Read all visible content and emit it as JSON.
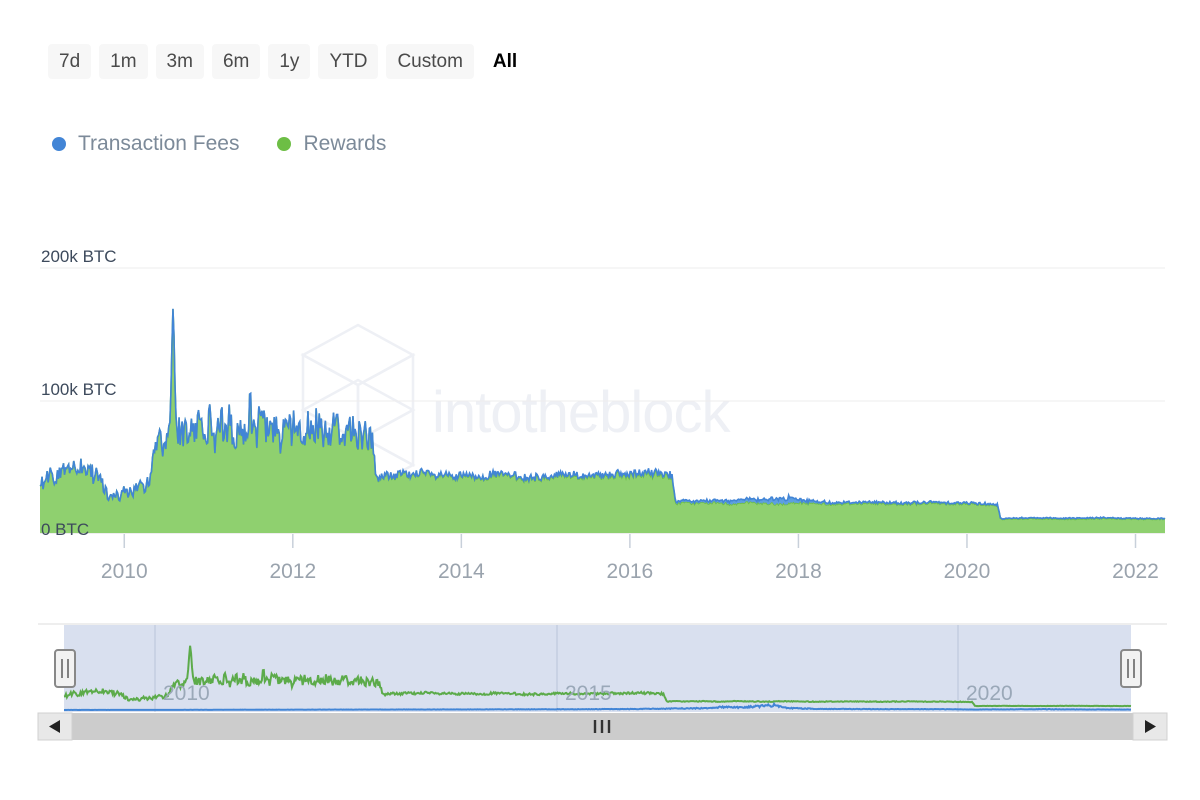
{
  "range_selector": {
    "buttons": [
      {
        "label": "7d",
        "selected": false
      },
      {
        "label": "1m",
        "selected": false
      },
      {
        "label": "3m",
        "selected": false
      },
      {
        "label": "6m",
        "selected": false
      },
      {
        "label": "1y",
        "selected": false
      },
      {
        "label": "YTD",
        "selected": false
      },
      {
        "label": "Custom",
        "selected": false
      },
      {
        "label": "All",
        "selected": true
      }
    ]
  },
  "legend": {
    "items": [
      {
        "label": "Transaction Fees",
        "color": "#4285d6"
      },
      {
        "label": "Rewards",
        "color": "#6dbe45"
      }
    ]
  },
  "watermark": {
    "text": "intotheblock"
  },
  "navigator": {
    "year_labels": [
      "2010",
      "2015",
      "2020"
    ],
    "left_arrow": "◀",
    "right_arrow": "▶"
  },
  "chart_data": {
    "type": "area",
    "title": "",
    "subtitle": "",
    "xlabel": "",
    "ylabel": "BTC",
    "stacked": true,
    "grid": true,
    "legend_position": "top-left",
    "ylim": [
      0,
      200000
    ],
    "ytick_values": [
      0,
      100000,
      200000
    ],
    "ytick_labels": [
      "0 BTC",
      "100k BTC",
      "200k BTC"
    ],
    "xlim": [
      "2009-01",
      "2022-04"
    ],
    "xtick_labels": [
      "2010",
      "2012",
      "2014",
      "2016",
      "2018",
      "2020",
      "2022"
    ],
    "navigator_xtick_labels": [
      "2010",
      "2015",
      "2020"
    ],
    "series": [
      {
        "name": "Rewards",
        "color": "#6dbe45",
        "fill_color": "#8fd06f",
        "x": [
          "2009.05",
          "2009.12",
          "2009.2",
          "2009.28",
          "2009.36",
          "2009.44",
          "2009.5",
          "2009.58",
          "2009.66",
          "2009.74",
          "2009.8",
          "2009.88",
          "2009.96",
          "2010.04",
          "2010.1",
          "2010.18",
          "2010.24",
          "2010.3",
          "2010.36",
          "2010.42",
          "2010.46",
          "2010.5",
          "2010.54",
          "2010.58",
          "2010.62",
          "2010.66",
          "2010.72",
          "2010.78",
          "2010.84",
          "2010.9",
          "2010.96",
          "2011.02",
          "2011.08",
          "2011.14",
          "2011.2",
          "2011.26",
          "2011.32",
          "2011.38",
          "2011.44",
          "2011.5",
          "2011.56",
          "2011.62",
          "2011.68",
          "2011.74",
          "2011.8",
          "2011.86",
          "2011.92",
          "2011.98",
          "2012.04",
          "2012.1",
          "2012.16",
          "2012.22",
          "2012.28",
          "2012.34",
          "2012.4",
          "2012.46",
          "2012.52",
          "2012.58",
          "2012.64",
          "2012.7",
          "2012.76",
          "2012.82",
          "2012.88",
          "2012.94",
          "2013.0",
          "2013.1",
          "2013.2",
          "2013.3",
          "2013.4",
          "2013.5",
          "2013.6",
          "2013.7",
          "2013.8",
          "2013.9",
          "2014.0",
          "2014.2",
          "2014.4",
          "2014.6",
          "2014.8",
          "2015.0",
          "2015.2",
          "2015.4",
          "2015.6",
          "2015.8",
          "2016.0",
          "2016.2",
          "2016.4",
          "2016.5",
          "2016.54",
          "2016.6",
          "2016.8",
          "2017.0",
          "2017.2",
          "2017.4",
          "2017.6",
          "2017.8",
          "2018.0",
          "2018.4",
          "2018.8",
          "2019.2",
          "2019.6",
          "2020.0",
          "2020.3",
          "2020.36",
          "2020.4",
          "2020.8",
          "2021.2",
          "2021.6",
          "2022.0",
          "2022.3"
        ],
        "values": [
          38000,
          44000,
          41000,
          45000,
          47000,
          49000,
          48000,
          46000,
          43000,
          36000,
          30000,
          27000,
          29000,
          32000,
          30000,
          34000,
          36000,
          40000,
          58000,
          72000,
          66000,
          75000,
          70000,
          175000,
          68000,
          80000,
          74000,
          86000,
          70000,
          90000,
          76000,
          84000,
          68000,
          92000,
          74000,
          88000,
          62000,
          86000,
          72000,
          94000,
          68000,
          90000,
          78000,
          72000,
          80000,
          70000,
          84000,
          76000,
          82000,
          74000,
          80000,
          78000,
          82000,
          76000,
          80000,
          78000,
          82000,
          76000,
          80000,
          78000,
          74000,
          76000,
          72000,
          70000,
          40000,
          44000,
          42000,
          45000,
          43000,
          46000,
          44000,
          42000,
          44000,
          41000,
          43000,
          42000,
          44000,
          43000,
          41000,
          42000,
          44000,
          43000,
          42000,
          44000,
          43000,
          45000,
          44000,
          43000,
          22000,
          23000,
          22500,
          23000,
          22000,
          23000,
          22500,
          22000,
          23000,
          22000,
          22500,
          22000,
          22500,
          22000,
          21500,
          21000,
          10500,
          11000,
          10500,
          11000,
          10500,
          10500,
          10500
        ]
      },
      {
        "name": "Transaction Fees",
        "color": "#4285d6",
        "fill_color": "#5d9fe0",
        "x": [
          "2009.05",
          "2010.0",
          "2011.0",
          "2012.0",
          "2013.0",
          "2014.0",
          "2015.0",
          "2016.0",
          "2016.6",
          "2017.0",
          "2017.3",
          "2017.5",
          "2017.7",
          "2017.9",
          "2018.0",
          "2018.2",
          "2018.5",
          "2019.0",
          "2019.5",
          "2020.0",
          "2020.36",
          "2020.6",
          "2021.0",
          "2021.3",
          "2021.6",
          "2022.0",
          "2022.3"
        ],
        "values": [
          60,
          80,
          200,
          300,
          400,
          500,
          600,
          800,
          1200,
          1600,
          2800,
          2200,
          3400,
          4200,
          2000,
          1400,
          900,
          800,
          700,
          700,
          400,
          500,
          600,
          700,
          500,
          400,
          400
        ]
      }
    ]
  }
}
